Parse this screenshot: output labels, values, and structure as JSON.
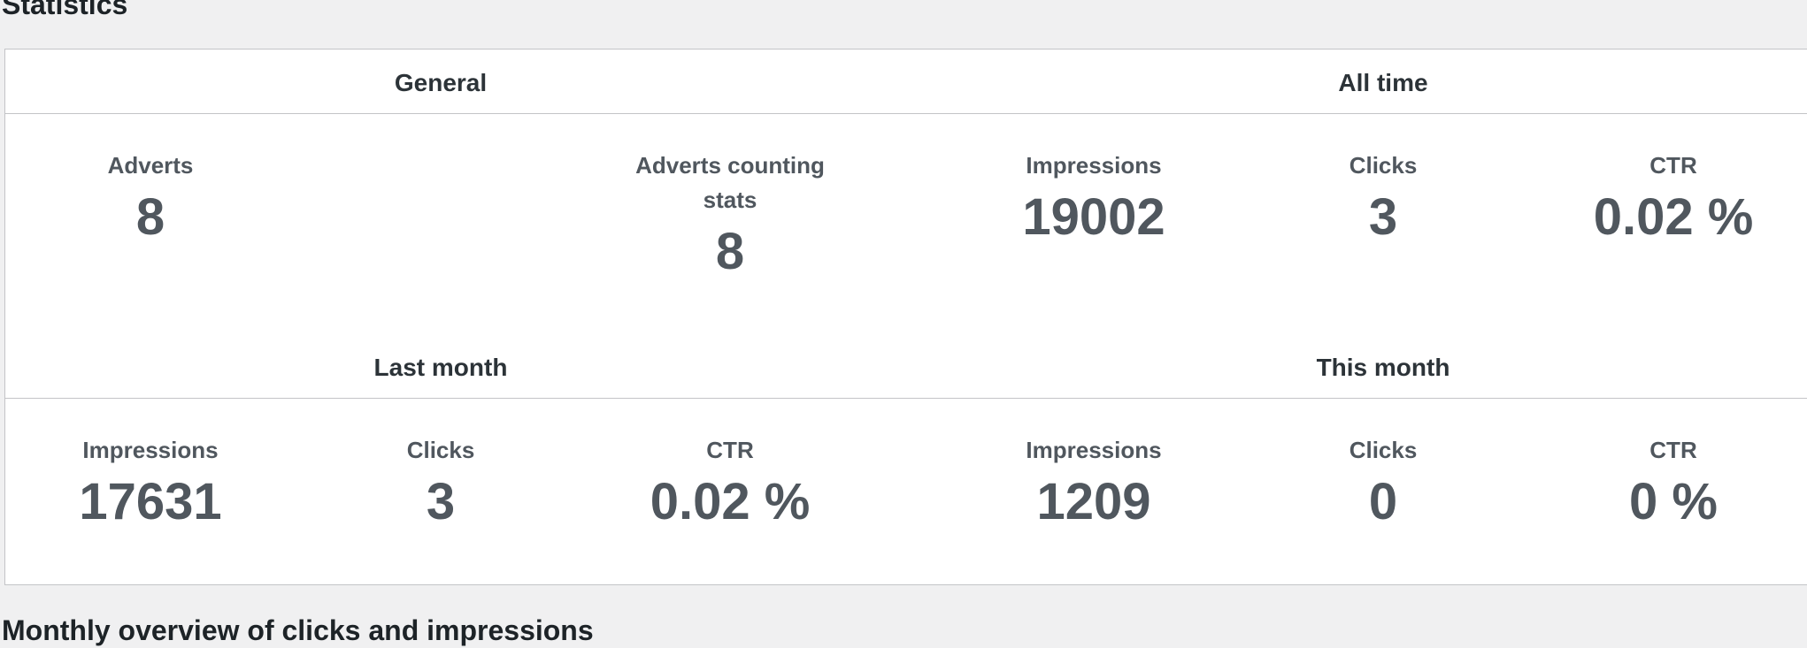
{
  "page": {
    "title": "Statistics",
    "next_title": "Monthly overview of clicks and impressions"
  },
  "general": {
    "title": "General",
    "adverts_label": "Adverts",
    "adverts_value": "8",
    "counting_label": "Adverts counting stats",
    "counting_value": "8"
  },
  "all_time": {
    "title": "All time",
    "impressions_label": "Impressions",
    "impressions_value": "19002",
    "clicks_label": "Clicks",
    "clicks_value": "3",
    "ctr_label": "CTR",
    "ctr_value": "0.02 %"
  },
  "last_month": {
    "title": "Last month",
    "impressions_label": "Impressions",
    "impressions_value": "17631",
    "clicks_label": "Clicks",
    "clicks_value": "3",
    "ctr_label": "CTR",
    "ctr_value": "0.02 %"
  },
  "this_month": {
    "title": "This month",
    "impressions_label": "Impressions",
    "impressions_value": "1209",
    "clicks_label": "Clicks",
    "clicks_value": "0",
    "ctr_label": "CTR",
    "ctr_value": "0 %"
  }
}
